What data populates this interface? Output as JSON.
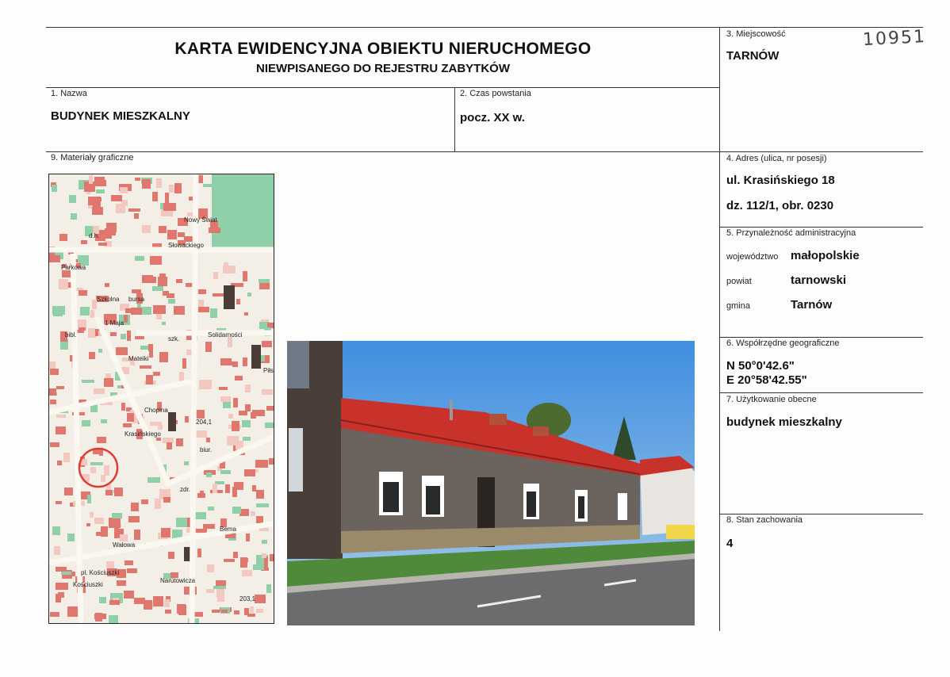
{
  "header": {
    "title": "KARTA EWIDENCYJNA OBIEKTU NIERUCHOMEGO",
    "subtitle": "NIEWPISANEGO DO REJESTRU ZABYTKÓW",
    "handwritten_number": "10951"
  },
  "fields": {
    "nazwa": {
      "label": "1. Nazwa",
      "value": "BUDYNEK MIESZKALNY"
    },
    "czas": {
      "label": "2. Czas powstania",
      "value": "pocz. XX w."
    },
    "miejscowosc": {
      "label": "3. Miejscowość",
      "value": "TARNÓW"
    },
    "adres": {
      "label": "4. Adres (ulica, nr posesji)",
      "line1": "ul. Krasińskiego 18",
      "line2": "dz. 112/1, obr. 0230"
    },
    "przynaleznosc": {
      "label": "5. Przynależność administracyjna",
      "wojewodztwo_label": "województwo",
      "wojewodztwo": "małopolskie",
      "powiat_label": "powiat",
      "powiat": "tarnowski",
      "gmina_label": "gmina",
      "gmina": "Tarnów"
    },
    "wspolrzedne": {
      "label": "6. Współrzędne geograficzne",
      "n": "N 50°0'42.6\"",
      "e": "E 20°58'42.55\""
    },
    "uzytkowanie": {
      "label": "7. Użytkowanie obecne",
      "value": "budynek mieszkalny"
    },
    "stan": {
      "label": "8. Stan zachowania",
      "value": "4"
    },
    "materialy": {
      "label": "9. Materiały graficzne"
    }
  },
  "map": {
    "street_labels": [
      "Słowackiego",
      "Solidarności",
      "Mateiki",
      "Bema",
      "Narutowicza",
      "Nowy Świat",
      "Krasińskiego",
      "Szkolna",
      "Chopina",
      "Wałowa",
      "Piłsudskiego",
      "Kościuszki",
      "Parkowa",
      "1 Maja",
      "bursa",
      "szk.",
      "biur.",
      "d.h.",
      "204,1",
      "203,1",
      "pl. Kościuszki",
      "zdr.",
      "bibl."
    ],
    "colors": {
      "built": "#e0776f",
      "green": "#8fd0a8",
      "road": "#f4efe6",
      "pale": "#f2c8c0",
      "highlight": "#e23a2e"
    }
  },
  "photo": {
    "colors": {
      "sky": "#5aa0e0",
      "roof": "#c8322b",
      "wall": "#5a5450",
      "grass": "#4f8a3a",
      "road": "#6c6c6e"
    }
  }
}
